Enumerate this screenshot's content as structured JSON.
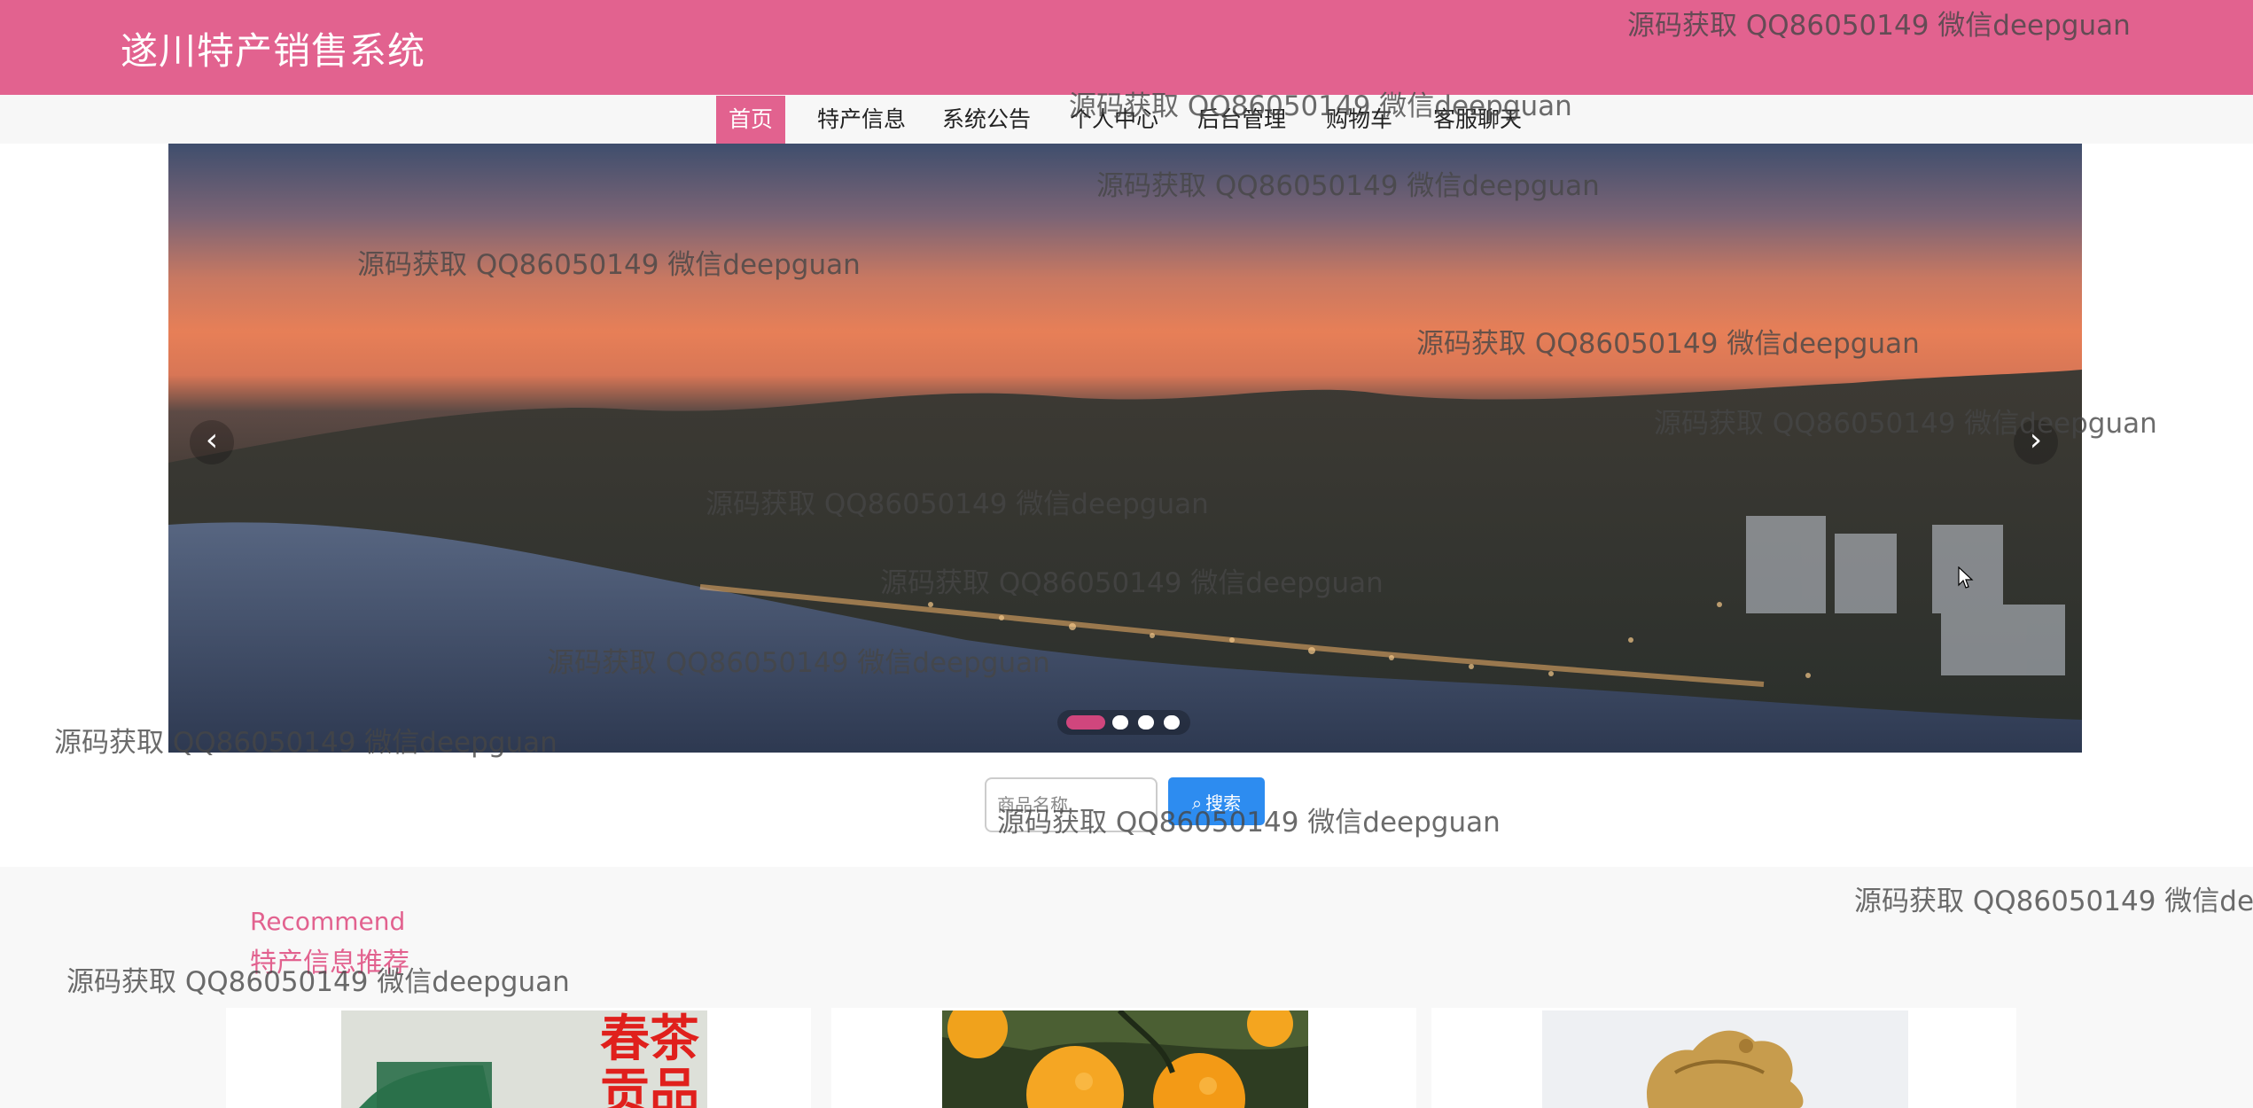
{
  "header": {
    "site_title": "遂川特产销售系统"
  },
  "nav": {
    "items": [
      {
        "label": "首页",
        "active": true
      },
      {
        "label": "特产信息",
        "active": false
      },
      {
        "label": "系统公告",
        "active": false
      },
      {
        "label": "个人中心",
        "active": false
      },
      {
        "label": "后台管理",
        "active": false
      },
      {
        "label": "购物车",
        "active": false
      },
      {
        "label": "客服聊天",
        "active": false
      }
    ]
  },
  "carousel": {
    "prev_icon": "chevron-left-icon",
    "next_icon": "chevron-right-icon",
    "slide_count": 4,
    "active_slide": 1
  },
  "search": {
    "placeholder": "商品名称",
    "button_label": "搜索",
    "button_icon": "search-icon"
  },
  "recommend": {
    "title_en": "Recommend",
    "title_cn": "特产信息推荐",
    "product_images": [
      "春茶贡品 tea package",
      "oranges on tree",
      "dried ginger slices"
    ],
    "tea_package_text": "春茶贡品"
  },
  "watermark": {
    "text": "源码获取 QQ86050149 微信deepguan"
  },
  "colors": {
    "brand": "#e2628f",
    "nav_bg": "#f7f7f7",
    "search_button": "#2d8cf0",
    "active_dot": "#d0467d"
  }
}
